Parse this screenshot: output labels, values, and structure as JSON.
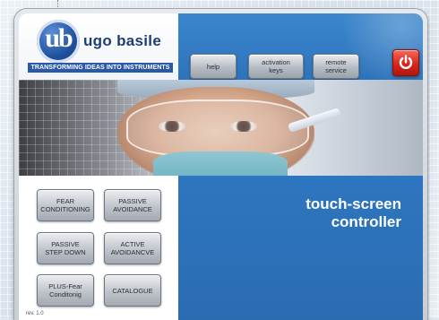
{
  "logo": {
    "mark": "ub",
    "name": "ugo basile",
    "tagline": "TRANSFORMING IDEAS INTO INSTRUMENTS"
  },
  "header": {
    "buttons": [
      {
        "label": "help"
      },
      {
        "label": "activation\nkeys"
      },
      {
        "label": "remote\nservice"
      }
    ],
    "power_icon": "power-icon"
  },
  "main": {
    "tagline_line1": "touch-screen",
    "tagline_line2": "controller",
    "buttons": [
      {
        "label": "FEAR\nCONDITIONING"
      },
      {
        "label": "PASSIVE\nAVOIDANCE"
      },
      {
        "label": "PASSIVE\nSTEP DOWN"
      },
      {
        "label": "ACTIVE\nAVOIDANCVE"
      },
      {
        "label": "PLUS-Fear\nConditonig"
      },
      {
        "label": "CATALOGUE"
      }
    ]
  },
  "footer": {
    "revision": "rev. 1.0"
  },
  "colors": {
    "header_blue": "#3b86cc",
    "panel_blue": "#2e76c0",
    "power_red": "#d8261b",
    "logo_blue": "#1f4f9c"
  }
}
